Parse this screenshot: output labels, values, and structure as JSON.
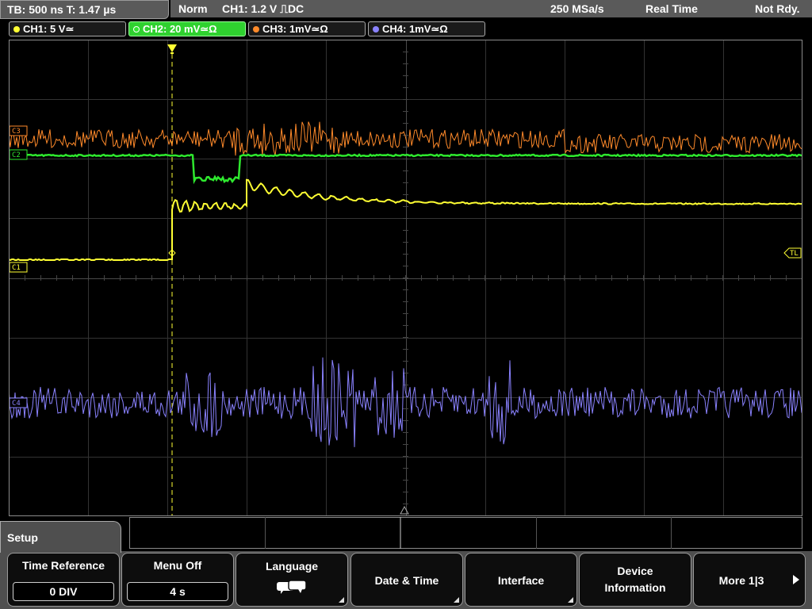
{
  "status": {
    "timebase": "TB: 500 ns  T: 1.47 µs",
    "mode": "Norm",
    "trigger": "CH1: 1.2 V ⎍DC",
    "sample_rate": "250 MSa/s",
    "acq_mode": "Real Time",
    "state": "Not Rdy."
  },
  "channels": [
    {
      "label": "CH1: 5 V≃",
      "color": "#ffff33"
    },
    {
      "label": "CH2: 20 mV≃Ω",
      "color": "#2ee82e"
    },
    {
      "label": "CH3: 1mV≃Ω",
      "color": "#ff8a2a"
    },
    {
      "label": "CH4: 1mV≃Ω",
      "color": "#8a82ff"
    }
  ],
  "markers": {
    "ch1": "C1",
    "ch2": "C2",
    "ch3": "C3",
    "ch4": "C4",
    "trigger_level": "TL"
  },
  "menu": {
    "title": "Setup",
    "softkeys": {
      "time_reference": {
        "label": "Time Reference",
        "value": "0 DIV"
      },
      "menu_off": {
        "label": "Menu Off",
        "value": "4 s"
      },
      "language": {
        "label": "Language",
        "icon": "speech-bubble-icon"
      },
      "date_time": {
        "label": "Date & Time"
      },
      "interface": {
        "label": "Interface"
      },
      "device_information": {
        "line1": "Device",
        "line2": "Information"
      },
      "more": {
        "label": "More 1|3"
      }
    }
  }
}
